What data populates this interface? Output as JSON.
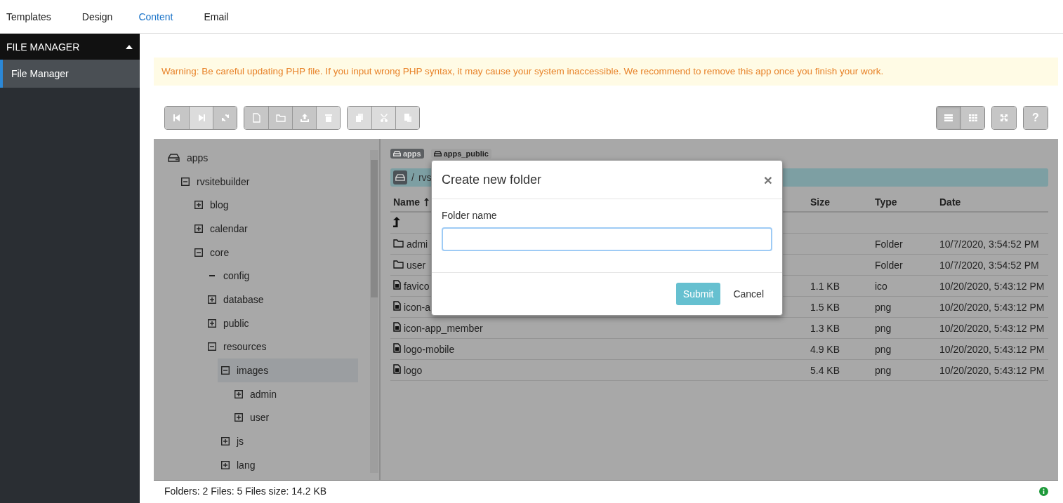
{
  "top_nav": {
    "tabs": [
      {
        "label": "Templates",
        "selected": false
      },
      {
        "label": "Design",
        "selected": false
      },
      {
        "label": "Content",
        "selected": true
      },
      {
        "label": "Email",
        "selected": false
      }
    ]
  },
  "sidebar": {
    "header": "FILE MANAGER",
    "expanded": true,
    "items": [
      {
        "label": "File Manager",
        "selected": true
      }
    ]
  },
  "warning": "Warning: Be careful updating PHP file. If you input wrong PHP syntax, it may cause your system inaccessible. We recommend to remove this app once you finish your work.",
  "toolbar": {
    "groups": [
      [
        {
          "kind": "first",
          "disabled": false
        },
        {
          "kind": "next",
          "disabled": true
        },
        {
          "kind": "refresh",
          "disabled": false
        }
      ],
      [
        {
          "kind": "new-file",
          "disabled": false
        },
        {
          "kind": "new-folder",
          "disabled": false
        },
        {
          "kind": "upload",
          "disabled": false
        },
        {
          "kind": "delete",
          "disabled": true
        }
      ],
      [
        {
          "kind": "copy",
          "disabled": true
        },
        {
          "kind": "cut",
          "disabled": true
        },
        {
          "kind": "paste",
          "disabled": true
        }
      ]
    ],
    "right_groups": [
      [
        {
          "kind": "list",
          "disabled": false,
          "selected": true
        },
        {
          "kind": "grid",
          "disabled": false,
          "selected": false
        }
      ],
      [
        {
          "kind": "fullscreen",
          "disabled": false,
          "selected": false
        }
      ],
      [
        {
          "kind": "help",
          "label": "?",
          "disabled": false,
          "selected": false
        }
      ]
    ]
  },
  "tree": [
    {
      "label": "apps",
      "kind": "drive",
      "selected": false,
      "children": [
        {
          "label": "rvsitebuilder",
          "expanded": true,
          "selected": false,
          "children": [
            {
              "label": "blog",
              "expanded": false,
              "selected": false
            },
            {
              "label": "calendar",
              "expanded": false,
              "selected": false
            },
            {
              "label": "core",
              "expanded": true,
              "selected": false,
              "children": [
                {
                  "label": "config",
                  "expanded": true,
                  "selected": false
                },
                {
                  "label": "database",
                  "expanded": false,
                  "selected": false
                },
                {
                  "label": "public",
                  "expanded": false,
                  "selected": false
                },
                {
                  "label": "resources",
                  "expanded": true,
                  "selected": false,
                  "children": [
                    {
                      "label": "images",
                      "expanded": true,
                      "selected": true,
                      "children": [
                        {
                          "label": "admin",
                          "expanded": false,
                          "selected": false
                        },
                        {
                          "label": "user",
                          "expanded": false,
                          "selected": false
                        }
                      ]
                    },
                    {
                      "label": "js",
                      "expanded": false,
                      "selected": false
                    },
                    {
                      "label": "lang",
                      "expanded": false,
                      "selected": false
                    }
                  ]
                }
              ]
            }
          ]
        }
      ]
    }
  ],
  "breadcrumb": {
    "tags": [
      {
        "label": "apps",
        "selected": true
      },
      {
        "label": "apps_public",
        "selected": false
      }
    ],
    "separator": "/",
    "path": [
      "rvs"
    ]
  },
  "table": {
    "columns": [
      {
        "label": "Name",
        "sorted": true
      },
      {
        "label": "Size",
        "sorted": false
      },
      {
        "label": "Type",
        "sorted": false
      },
      {
        "label": "Date",
        "sorted": false
      }
    ],
    "rows": [
      {
        "kind": "up"
      },
      {
        "kind": "folder",
        "name": "admi",
        "type": "Folder",
        "date": "10/7/2020, 3:54:52 PM"
      },
      {
        "kind": "folder",
        "name": "user",
        "type": "Folder",
        "date": "10/7/2020, 3:54:52 PM"
      },
      {
        "kind": "file",
        "name": "favico",
        "size": "1.1 KB",
        "type": "ico",
        "date": "10/20/2020, 5:43:12 PM"
      },
      {
        "kind": "file",
        "name": "icon-a",
        "size": "1.5 KB",
        "type": "png",
        "date": "10/20/2020, 5:43:12 PM"
      },
      {
        "kind": "file",
        "name": "icon-app_member",
        "size": "1.3 KB",
        "type": "png",
        "date": "10/20/2020, 5:43:12 PM"
      },
      {
        "kind": "file",
        "name": "logo-mobile",
        "size": "4.9 KB",
        "type": "png",
        "date": "10/20/2020, 5:43:12 PM"
      },
      {
        "kind": "file",
        "name": "logo",
        "size": "5.4 KB",
        "type": "png",
        "date": "10/20/2020, 5:43:12 PM"
      }
    ]
  },
  "status_bar": {
    "text": "Folders: 2 Files: 5 Files size: 14.2 KB"
  },
  "dialog": {
    "title": "Create new folder",
    "close": "×",
    "label": "Folder name",
    "buttons": [
      {
        "label": "Submit",
        "kind": "primary"
      },
      {
        "label": "Cancel",
        "kind": "link"
      }
    ]
  }
}
